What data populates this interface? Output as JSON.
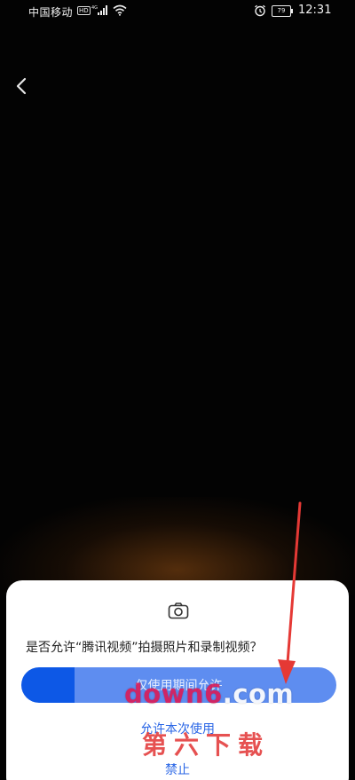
{
  "status_bar": {
    "carrier": "中国移动",
    "hd_badge": "HD",
    "battery": "79",
    "time": "12:31"
  },
  "dialog": {
    "icon": "camera-icon",
    "question": "是否允许“腾讯视频”拍摄照片和录制视频？",
    "primary_label": "仅使用期间允许",
    "once_label": "允许本次使用",
    "deny_label": "禁止"
  },
  "watermark": {
    "url_prefix": "down6",
    "url_suffix": ".com",
    "site_name": "第六下载"
  },
  "colors": {
    "accent": "#2a66e6",
    "primary_button": "#5e8df0",
    "primary_button_dark": "#0d58e6",
    "annotation_arrow": "#e53935"
  }
}
